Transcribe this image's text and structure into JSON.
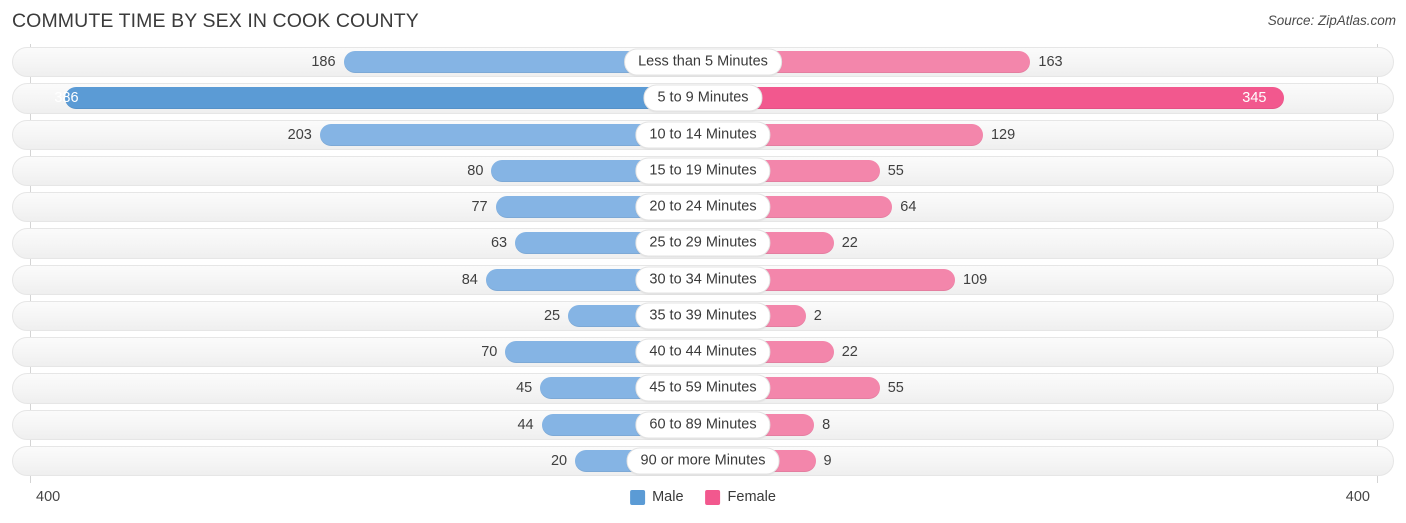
{
  "header": {
    "title": "COMMUTE TIME BY SEX IN COOK COUNTY",
    "source": "Source: ZipAtlas.com"
  },
  "axis": {
    "left_max": "400",
    "right_max": "400",
    "max_value": 400
  },
  "legend": {
    "items": [
      {
        "label": "Male",
        "color": "#5b9bd5"
      },
      {
        "label": "Female",
        "color": "#f2588e"
      }
    ]
  },
  "colors": {
    "male": "#85b4e4",
    "male_peak": "#5b9bd5",
    "female": "#f386ab",
    "female_peak": "#f2588e"
  },
  "chart_data": {
    "type": "bar",
    "title": "COMMUTE TIME BY SEX IN COOK COUNTY",
    "subtitle": "Source: ZipAtlas.com",
    "orientation": "horizontal-diverging",
    "xlabel": "",
    "ylabel": "",
    "xlim": [
      -400,
      400
    ],
    "grid": false,
    "legend_position": "bottom-center",
    "categories": [
      "Less than 5 Minutes",
      "5 to 9 Minutes",
      "10 to 14 Minutes",
      "15 to 19 Minutes",
      "20 to 24 Minutes",
      "25 to 29 Minutes",
      "30 to 34 Minutes",
      "35 to 39 Minutes",
      "40 to 44 Minutes",
      "45 to 59 Minutes",
      "60 to 89 Minutes",
      "90 or more Minutes"
    ],
    "series": [
      {
        "name": "Male",
        "values": [
          186,
          386,
          203,
          80,
          77,
          63,
          84,
          25,
          70,
          45,
          44,
          20
        ]
      },
      {
        "name": "Female",
        "values": [
          163,
          345,
          129,
          55,
          64,
          22,
          109,
          2,
          22,
          55,
          8,
          9
        ]
      }
    ]
  },
  "rows": [
    {
      "category": "Less than 5 Minutes",
      "male": "186",
      "female": "163",
      "male_value": 186,
      "female_value": 163
    },
    {
      "category": "5 to 9 Minutes",
      "male": "386",
      "female": "345",
      "male_value": 386,
      "female_value": 345
    },
    {
      "category": "10 to 14 Minutes",
      "male": "203",
      "female": "129",
      "male_value": 203,
      "female_value": 129
    },
    {
      "category": "15 to 19 Minutes",
      "male": "80",
      "female": "55",
      "male_value": 80,
      "female_value": 55
    },
    {
      "category": "20 to 24 Minutes",
      "male": "77",
      "female": "64",
      "male_value": 77,
      "female_value": 64
    },
    {
      "category": "25 to 29 Minutes",
      "male": "63",
      "female": "22",
      "male_value": 63,
      "female_value": 22
    },
    {
      "category": "30 to 34 Minutes",
      "male": "84",
      "female": "109",
      "male_value": 84,
      "female_value": 109
    },
    {
      "category": "35 to 39 Minutes",
      "male": "25",
      "female": "2",
      "male_value": 25,
      "female_value": 2
    },
    {
      "category": "40 to 44 Minutes",
      "male": "70",
      "female": "22",
      "male_value": 70,
      "female_value": 22
    },
    {
      "category": "45 to 59 Minutes",
      "male": "45",
      "female": "55",
      "male_value": 45,
      "female_value": 55
    },
    {
      "category": "60 to 89 Minutes",
      "male": "44",
      "female": "8",
      "male_value": 44,
      "female_value": 8
    },
    {
      "category": "90 or more Minutes",
      "male": "20",
      "female": "9",
      "male_value": 20,
      "female_value": 9
    }
  ]
}
